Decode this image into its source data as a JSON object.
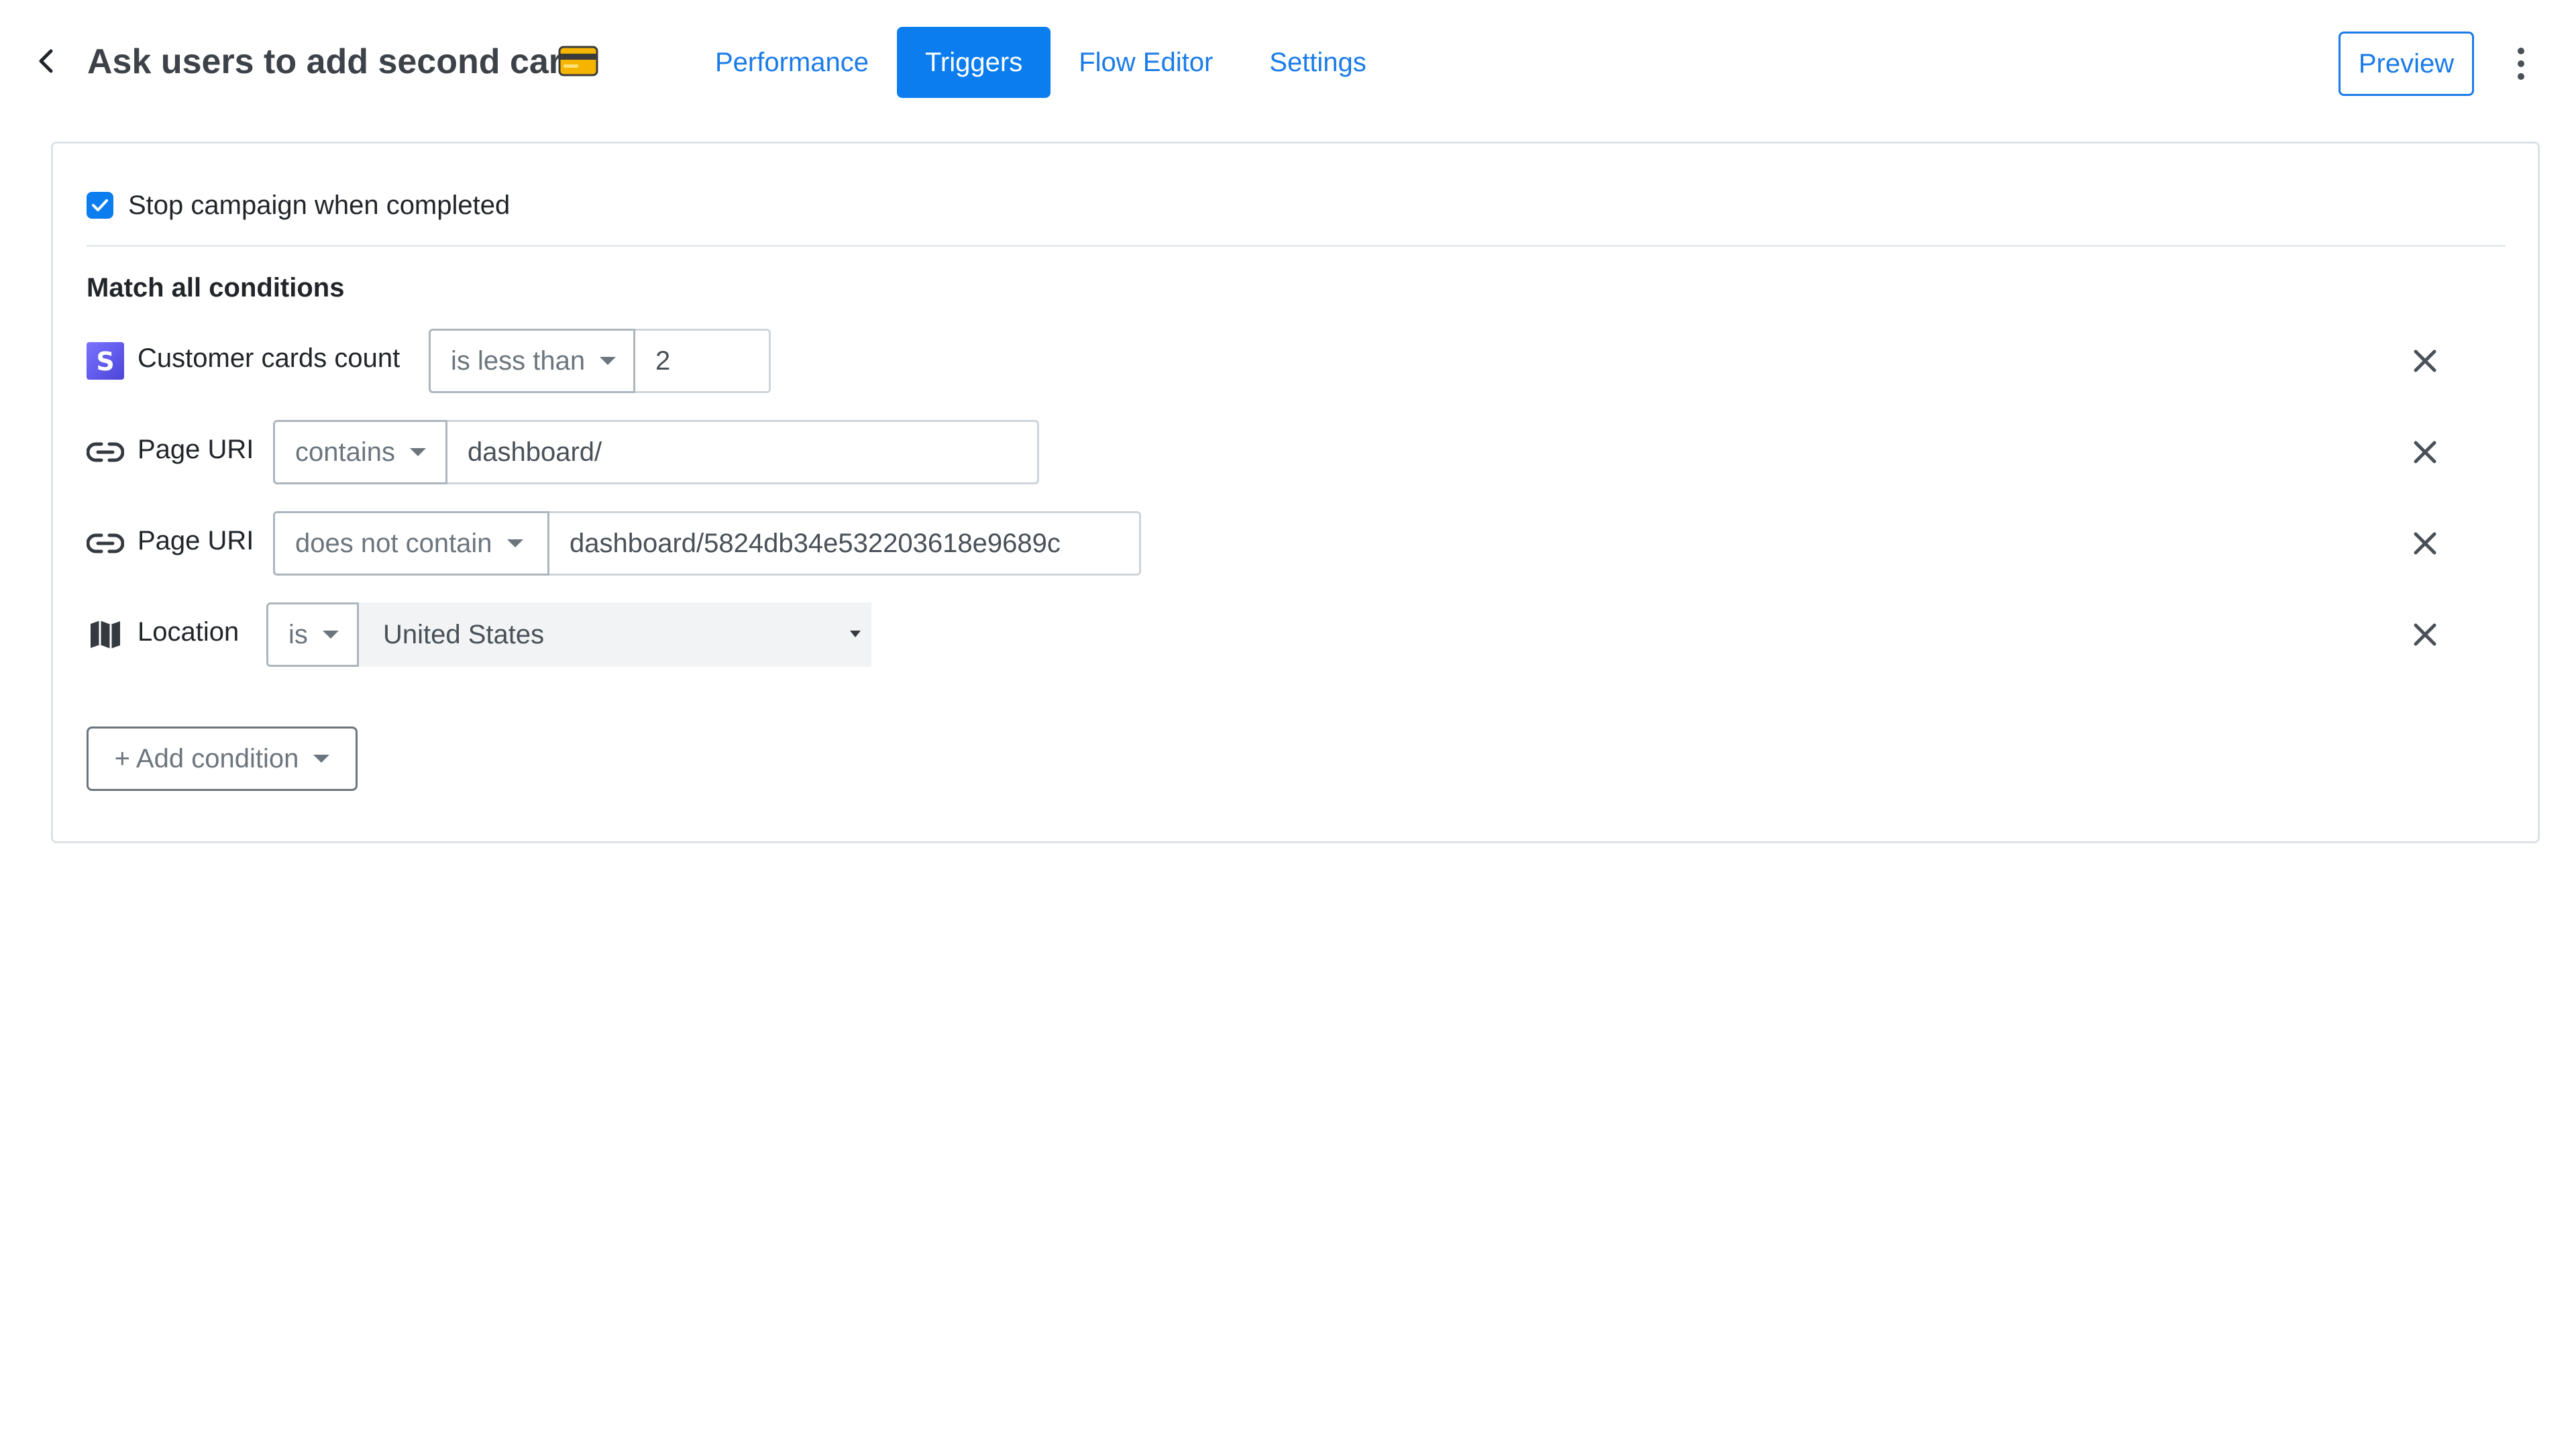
{
  "header": {
    "title": "Ask users to add second card",
    "tabs": [
      {
        "label": "Performance",
        "active": false
      },
      {
        "label": "Triggers",
        "active": true
      },
      {
        "label": "Flow Editor",
        "active": false
      },
      {
        "label": "Settings",
        "active": false
      }
    ],
    "preview_label": "Preview",
    "icons": {
      "back": "chevron-left-icon",
      "title_emoji": "credit-card-icon",
      "menu": "kebab-menu-icon"
    }
  },
  "triggers": {
    "stop_campaign": {
      "label": "Stop campaign when completed",
      "checked": true
    },
    "match_label": "Match all conditions",
    "conditions": [
      {
        "icon": "stripe-icon",
        "label": "Customer cards count",
        "operator": "is less than",
        "value": "2"
      },
      {
        "icon": "link-icon",
        "label": "Page URI",
        "operator": "contains",
        "value": "dashboard/"
      },
      {
        "icon": "link-icon",
        "label": "Page URI",
        "operator": "does not contain",
        "value": "dashboard/5824db34e532203618e9689c"
      },
      {
        "icon": "map-icon",
        "label": "Location",
        "operator": "is",
        "value": "United States"
      }
    ],
    "add_condition_label": "+ Add condition"
  },
  "colors": {
    "accent": "#0b7dee",
    "link": "#1a7be8",
    "stripe": "#635bff",
    "border": "#dee2e6"
  }
}
